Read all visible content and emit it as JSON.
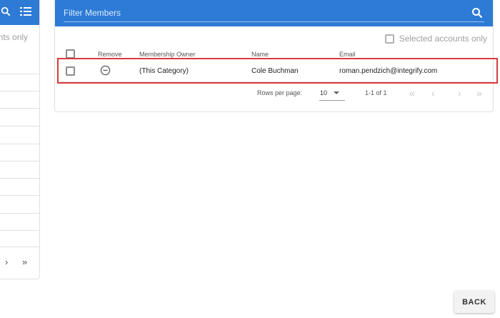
{
  "left_panel": {
    "accounts_only_text": "unts only",
    "pagination": {
      "next": "›",
      "last": "»"
    }
  },
  "filter": {
    "label": "Filter Members"
  },
  "selected_accounts": {
    "label": "Selected accounts only"
  },
  "table": {
    "headers": [
      "Remove",
      "Membership Owner",
      "Name",
      "Email"
    ],
    "rows": [
      {
        "membership_owner": "(This Category)",
        "name": "Cole Buchman",
        "email": "roman.pendzich@integrify.com"
      }
    ]
  },
  "footer": {
    "rows_per_page_label": "Rows per page:",
    "rows_per_page_value": "10",
    "range": "1-1 of 1",
    "first": "«",
    "prev": "‹",
    "next": "›",
    "last": "»"
  },
  "back_button": {
    "label": "BACK"
  },
  "colors": {
    "header": "#2e7bd6",
    "highlight": "#d93b3b"
  }
}
